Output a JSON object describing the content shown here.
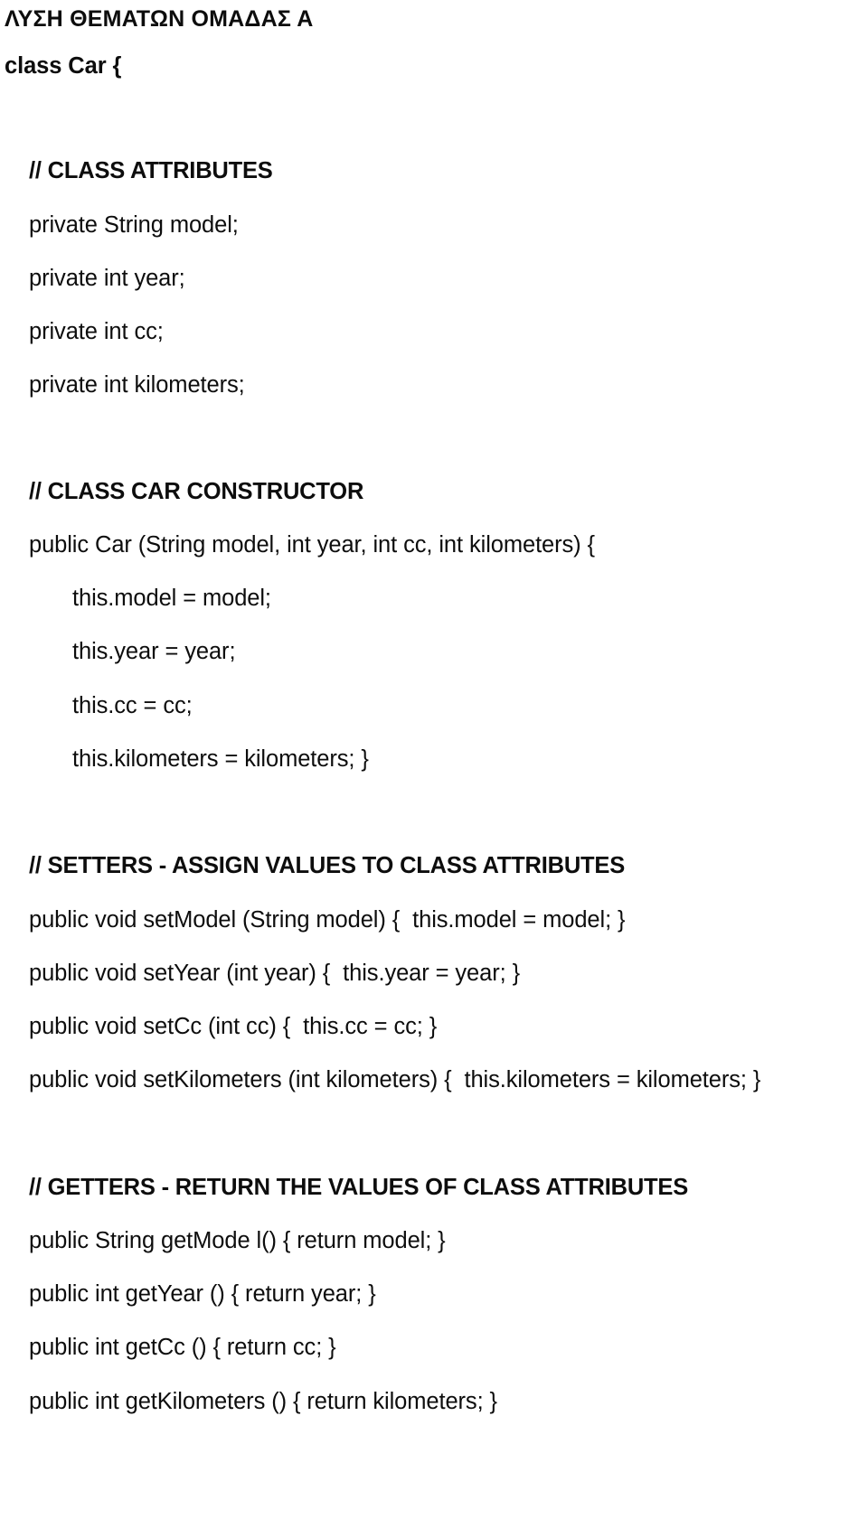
{
  "document": {
    "title": "ΛΥΣΗ ΘΕΜΑΤΩΝ ΟΜΑΔΑΣ Α",
    "language": "el",
    "background_color": "#ffffff",
    "text_color": "#0d0d0d"
  },
  "code": {
    "class_declaration": "class Car {",
    "sections": [
      {
        "id": "class-attributes",
        "header": "// CLASS ATTRIBUTES",
        "lines": [
          "private String model;",
          "private int year;",
          "private int cc;",
          "private int kilometers;"
        ]
      },
      {
        "id": "class-car-constructor",
        "header": "// CLASS CAR CONSTRUCTOR",
        "signature": "public Car (String model, int year, int cc, int kilometers) {",
        "body": [
          "this.model = model;",
          "this.year = year;",
          "this.cc = cc;",
          "this.kilometers = kilometers; }"
        ]
      },
      {
        "id": "setters",
        "header": "// SETTERS - ASSIGN VALUES TO CLASS ATTRIBUTES",
        "lines": [
          "public void setModel (String model) {  this.model = model; }",
          "public void setYear (int year) {  this.year = year; }",
          "public void setCc (int cc) {  this.cc = cc; }",
          "public void setKilometers (int kilometers) {  this.kilometers = kilometers; }"
        ]
      },
      {
        "id": "getters",
        "header": "// GETTERS - RETURN THE VALUES OF CLASS ATTRIBUTES",
        "lines": [
          "public String getMode l() { return model; }",
          "public int getYear () { return year; }",
          "public int getCc () { return cc; }",
          "public int getKilometers () { return kilometers; }"
        ]
      }
    ]
  }
}
